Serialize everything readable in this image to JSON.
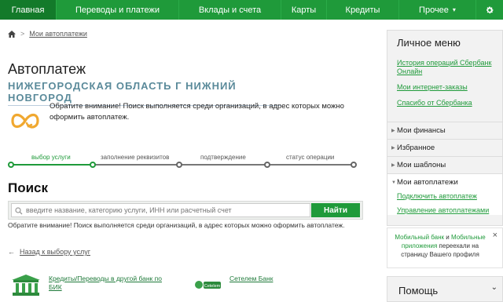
{
  "nav": {
    "home": "Главная",
    "transfers": "Переводы и платежи",
    "deposits": "Вклады и счета",
    "cards": "Карты",
    "credits": "Кредиты",
    "other": "Прочее",
    "other_chevron": "▾",
    "gear_icon": "gear-icon"
  },
  "breadcrumb": {
    "home_icon": "home-icon",
    "separator": ">",
    "link": "Мои автоплатежи"
  },
  "main": {
    "title": "Автоплатеж",
    "region": "НИЖЕГОРОДСКАЯ ОБЛАСТЬ Г НИЖНИЙ НОВГОРОД",
    "notice": "Обратите внимание! Поиск выполняется среди организаций, в адрес которых можно оформить автоплатеж.",
    "steps": [
      "выбор услуги",
      "заполнение реквизитов",
      "подтверждение",
      "статус операции"
    ],
    "active_step": 1
  },
  "search": {
    "title": "Поиск",
    "placeholder": "введите название, категорию услуги, ИНН или расчетный счет",
    "button": "Найти",
    "notice": "Обратите внимание! Поиск выполняется среди организаций, в адрес которых можно оформить автоплатеж."
  },
  "back_link": "Назад к выбору услуг",
  "results": [
    {
      "name": "Кредиты/Переводы в другой банк по БИК",
      "icon": "bank-icon"
    },
    {
      "name": "Сетелем Банк",
      "icon": "cetelem-logo",
      "logo_text": "Cetelem"
    }
  ],
  "sidebar": {
    "title": "Личное меню",
    "links": [
      "История операций Сбербанк Онлайн",
      "Мои интернет-заказы",
      "Спасибо от Сбербанка"
    ],
    "sections": [
      "Мои финансы",
      "Избранное",
      "Мои шаблоны",
      "Мои автоплатежи"
    ],
    "autopay_links": [
      "Подключить автоплатеж",
      "Управление автоплатежами"
    ]
  },
  "mobile_banner": {
    "part1": "Мобильный банк",
    "and": " и ",
    "part2": "Мобильные приложения",
    "rest": " переехали на страницу Вашего профиля",
    "close": "×"
  },
  "help": {
    "title": "Помощь",
    "chevron": "⌄"
  },
  "colors": {
    "brand_green": "#1f9a3a",
    "dark_green": "#137a2a",
    "region_blue": "#5a8a9a"
  }
}
